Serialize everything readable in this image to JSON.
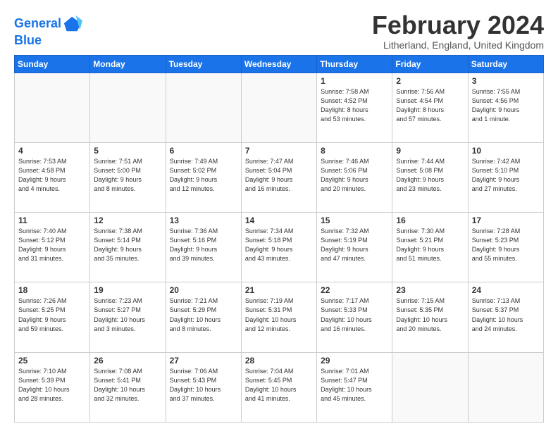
{
  "app": {
    "logo_line1": "General",
    "logo_line2": "Blue"
  },
  "header": {
    "month_year": "February 2024",
    "location": "Litherland, England, United Kingdom"
  },
  "weekdays": [
    "Sunday",
    "Monday",
    "Tuesday",
    "Wednesday",
    "Thursday",
    "Friday",
    "Saturday"
  ],
  "weeks": [
    [
      {
        "day": "",
        "info": ""
      },
      {
        "day": "",
        "info": ""
      },
      {
        "day": "",
        "info": ""
      },
      {
        "day": "",
        "info": ""
      },
      {
        "day": "1",
        "info": "Sunrise: 7:58 AM\nSunset: 4:52 PM\nDaylight: 8 hours\nand 53 minutes."
      },
      {
        "day": "2",
        "info": "Sunrise: 7:56 AM\nSunset: 4:54 PM\nDaylight: 8 hours\nand 57 minutes."
      },
      {
        "day": "3",
        "info": "Sunrise: 7:55 AM\nSunset: 4:56 PM\nDaylight: 9 hours\nand 1 minute."
      }
    ],
    [
      {
        "day": "4",
        "info": "Sunrise: 7:53 AM\nSunset: 4:58 PM\nDaylight: 9 hours\nand 4 minutes."
      },
      {
        "day": "5",
        "info": "Sunrise: 7:51 AM\nSunset: 5:00 PM\nDaylight: 9 hours\nand 8 minutes."
      },
      {
        "day": "6",
        "info": "Sunrise: 7:49 AM\nSunset: 5:02 PM\nDaylight: 9 hours\nand 12 minutes."
      },
      {
        "day": "7",
        "info": "Sunrise: 7:47 AM\nSunset: 5:04 PM\nDaylight: 9 hours\nand 16 minutes."
      },
      {
        "day": "8",
        "info": "Sunrise: 7:46 AM\nSunset: 5:06 PM\nDaylight: 9 hours\nand 20 minutes."
      },
      {
        "day": "9",
        "info": "Sunrise: 7:44 AM\nSunset: 5:08 PM\nDaylight: 9 hours\nand 23 minutes."
      },
      {
        "day": "10",
        "info": "Sunrise: 7:42 AM\nSunset: 5:10 PM\nDaylight: 9 hours\nand 27 minutes."
      }
    ],
    [
      {
        "day": "11",
        "info": "Sunrise: 7:40 AM\nSunset: 5:12 PM\nDaylight: 9 hours\nand 31 minutes."
      },
      {
        "day": "12",
        "info": "Sunrise: 7:38 AM\nSunset: 5:14 PM\nDaylight: 9 hours\nand 35 minutes."
      },
      {
        "day": "13",
        "info": "Sunrise: 7:36 AM\nSunset: 5:16 PM\nDaylight: 9 hours\nand 39 minutes."
      },
      {
        "day": "14",
        "info": "Sunrise: 7:34 AM\nSunset: 5:18 PM\nDaylight: 9 hours\nand 43 minutes."
      },
      {
        "day": "15",
        "info": "Sunrise: 7:32 AM\nSunset: 5:19 PM\nDaylight: 9 hours\nand 47 minutes."
      },
      {
        "day": "16",
        "info": "Sunrise: 7:30 AM\nSunset: 5:21 PM\nDaylight: 9 hours\nand 51 minutes."
      },
      {
        "day": "17",
        "info": "Sunrise: 7:28 AM\nSunset: 5:23 PM\nDaylight: 9 hours\nand 55 minutes."
      }
    ],
    [
      {
        "day": "18",
        "info": "Sunrise: 7:26 AM\nSunset: 5:25 PM\nDaylight: 9 hours\nand 59 minutes."
      },
      {
        "day": "19",
        "info": "Sunrise: 7:23 AM\nSunset: 5:27 PM\nDaylight: 10 hours\nand 3 minutes."
      },
      {
        "day": "20",
        "info": "Sunrise: 7:21 AM\nSunset: 5:29 PM\nDaylight: 10 hours\nand 8 minutes."
      },
      {
        "day": "21",
        "info": "Sunrise: 7:19 AM\nSunset: 5:31 PM\nDaylight: 10 hours\nand 12 minutes."
      },
      {
        "day": "22",
        "info": "Sunrise: 7:17 AM\nSunset: 5:33 PM\nDaylight: 10 hours\nand 16 minutes."
      },
      {
        "day": "23",
        "info": "Sunrise: 7:15 AM\nSunset: 5:35 PM\nDaylight: 10 hours\nand 20 minutes."
      },
      {
        "day": "24",
        "info": "Sunrise: 7:13 AM\nSunset: 5:37 PM\nDaylight: 10 hours\nand 24 minutes."
      }
    ],
    [
      {
        "day": "25",
        "info": "Sunrise: 7:10 AM\nSunset: 5:39 PM\nDaylight: 10 hours\nand 28 minutes."
      },
      {
        "day": "26",
        "info": "Sunrise: 7:08 AM\nSunset: 5:41 PM\nDaylight: 10 hours\nand 32 minutes."
      },
      {
        "day": "27",
        "info": "Sunrise: 7:06 AM\nSunset: 5:43 PM\nDaylight: 10 hours\nand 37 minutes."
      },
      {
        "day": "28",
        "info": "Sunrise: 7:04 AM\nSunset: 5:45 PM\nDaylight: 10 hours\nand 41 minutes."
      },
      {
        "day": "29",
        "info": "Sunrise: 7:01 AM\nSunset: 5:47 PM\nDaylight: 10 hours\nand 45 minutes."
      },
      {
        "day": "",
        "info": ""
      },
      {
        "day": "",
        "info": ""
      }
    ]
  ]
}
